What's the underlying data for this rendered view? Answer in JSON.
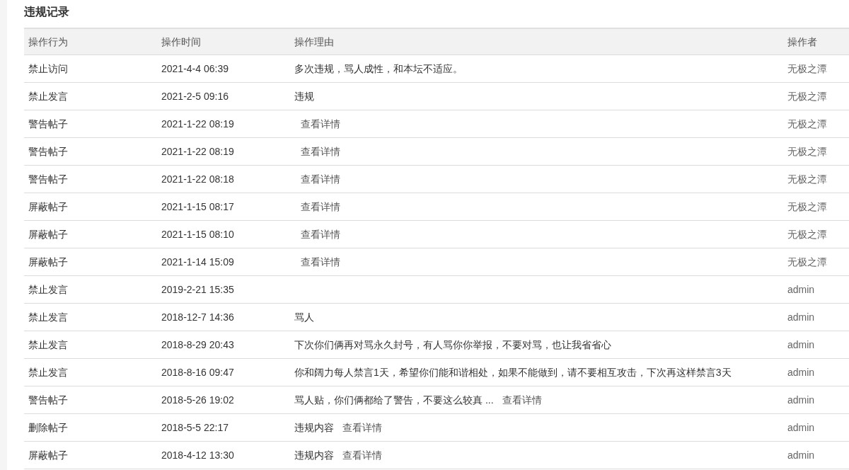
{
  "title": "违规记录",
  "table": {
    "columns": [
      "操作行为",
      "操作时间",
      "操作理由",
      "操作者"
    ],
    "rows": [
      {
        "action": "禁止访问",
        "time": "2021-4-4 06:39",
        "reason": [
          {
            "kind": "text",
            "text": "多次违规，骂人成性，和本坛不适应。"
          }
        ],
        "operator": "无极之潭"
      },
      {
        "action": "禁止发言",
        "time": "2021-2-5 09:16",
        "reason": [
          {
            "kind": "text",
            "text": "违规"
          }
        ],
        "operator": "无极之潭"
      },
      {
        "action": "警告帖子",
        "time": "2021-1-22 08:19",
        "reason": [
          {
            "kind": "link",
            "text": "查看详情"
          }
        ],
        "operator": "无极之潭"
      },
      {
        "action": "警告帖子",
        "time": "2021-1-22 08:19",
        "reason": [
          {
            "kind": "link",
            "text": "查看详情"
          }
        ],
        "operator": "无极之潭"
      },
      {
        "action": "警告帖子",
        "time": "2021-1-22 08:18",
        "reason": [
          {
            "kind": "link",
            "text": "查看详情"
          }
        ],
        "operator": "无极之潭"
      },
      {
        "action": "屏蔽帖子",
        "time": "2021-1-15 08:17",
        "reason": [
          {
            "kind": "link",
            "text": "查看详情"
          }
        ],
        "operator": "无极之潭"
      },
      {
        "action": "屏蔽帖子",
        "time": "2021-1-15 08:10",
        "reason": [
          {
            "kind": "link",
            "text": "查看详情"
          }
        ],
        "operator": "无极之潭"
      },
      {
        "action": "屏蔽帖子",
        "time": "2021-1-14 15:09",
        "reason": [
          {
            "kind": "link",
            "text": "查看详情"
          }
        ],
        "operator": "无极之潭"
      },
      {
        "action": "禁止发言",
        "time": "2019-2-21 15:35",
        "operator": "admin"
      },
      {
        "action": "禁止发言",
        "time": "2018-12-7 14:36",
        "reason": [
          {
            "kind": "text",
            "text": "骂人"
          }
        ],
        "operator": "admin"
      },
      {
        "action": "禁止发言",
        "time": "2018-8-29 20:43",
        "reason": [
          {
            "kind": "text",
            "text": "下次你们俩再对骂永久封号，有人骂你你举报，不要对骂，也让我省省心"
          }
        ],
        "operator": "admin"
      },
      {
        "action": "禁止发言",
        "time": "2018-8-16 09:47",
        "reason": [
          {
            "kind": "text",
            "text": "你和阔力每人禁言1天，希望你们能和谐相处，如果不能做到，请不要相互攻击，下次再这样禁言3天"
          }
        ],
        "operator": "admin"
      },
      {
        "action": "警告帖子",
        "time": "2018-5-26 19:02",
        "reason": [
          {
            "kind": "text",
            "text": "骂人贴，你们俩都给了警告，不要这么较真 ..."
          },
          {
            "kind": "link",
            "text": "查看详情"
          }
        ],
        "operator": "admin"
      },
      {
        "action": "删除帖子",
        "time": "2018-5-5 22:17",
        "reason": [
          {
            "kind": "text",
            "text": "违规内容"
          },
          {
            "kind": "link",
            "text": "查看详情"
          }
        ],
        "operator": "admin"
      },
      {
        "action": "屏蔽帖子",
        "time": "2018-4-12 13:30",
        "reason": [
          {
            "kind": "text",
            "text": "违规内容"
          },
          {
            "kind": "link",
            "text": "查看详情"
          }
        ],
        "operator": "admin"
      }
    ]
  }
}
